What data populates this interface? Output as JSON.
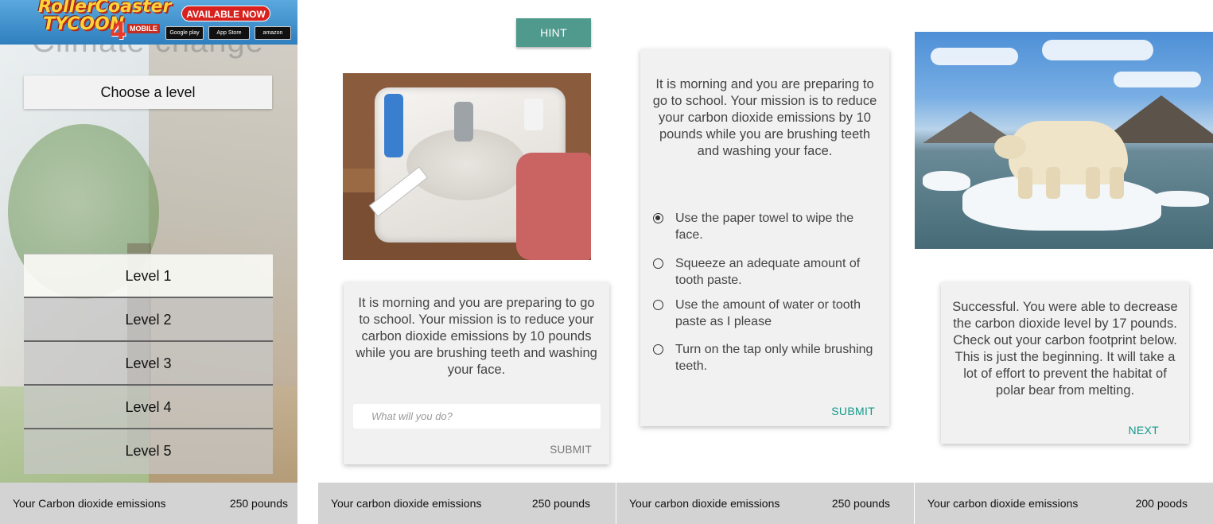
{
  "ad": {
    "logo_line1": "RollerCoaster",
    "logo_line2": "TYCOON",
    "logo_number": "4",
    "logo_mobile": "MOBILE",
    "banner": "AVAILABLE NOW",
    "store_google": "Google play",
    "store_apple": "App Store",
    "store_amazon": "amazon"
  },
  "screen1": {
    "faded_title": "Climate change",
    "choose_label": "Choose a level",
    "levels": [
      "Level 1",
      "Level 2",
      "Level 3",
      "Level 4",
      "Level 5"
    ],
    "emissions_label": "Your Carbon dioxide emissions",
    "emissions_value": "250 pounds"
  },
  "screen2": {
    "hint_label": "HINT",
    "mission_text": "It is morning and you are preparing to go to school. Your mission is to reduce your carbon dioxide emissions by 10 pounds while you are brushing teeth and washing your face.",
    "input_placeholder": "What will you do?",
    "submit_label": "SUBMIT",
    "emissions_label": "Your carbon dioxide emissions",
    "emissions_value": "250 pounds"
  },
  "screen3": {
    "mission_text": "It is morning and you are preparing to go to school. Your mission is to reduce your carbon dioxide emissions by 10 pounds while you are brushing teeth and washing your face.",
    "options": [
      {
        "label": "Use the paper towel to wipe the face.",
        "selected": true
      },
      {
        "label": "Squeeze an adequate amount of tooth paste.",
        "selected": false
      },
      {
        "label": "Use the amount of water or tooth paste as I please",
        "selected": false
      },
      {
        "label": "Turn on the tap only while brushing teeth.",
        "selected": false
      }
    ],
    "submit_label": "SUBMIT",
    "emissions_label": "Your carbon dioxide emissions",
    "emissions_value": "250 pounds"
  },
  "screen4": {
    "result_text": "Successful. You were able to decrease the carbon dioxide level by 17 pounds. Check out your carbon footprint below. This is just the beginning. It will take a lot of effort to prevent the habitat of polar bear from melting.",
    "next_label": "NEXT",
    "emissions_label": "Your carbon dioxide emissions",
    "emissions_value": "200 poods"
  },
  "colors": {
    "hint_bg": "#4f9a8d",
    "accent_teal": "#13998a",
    "card_bg": "#f1f1f1",
    "bar_bg": "#d3d3d3"
  }
}
